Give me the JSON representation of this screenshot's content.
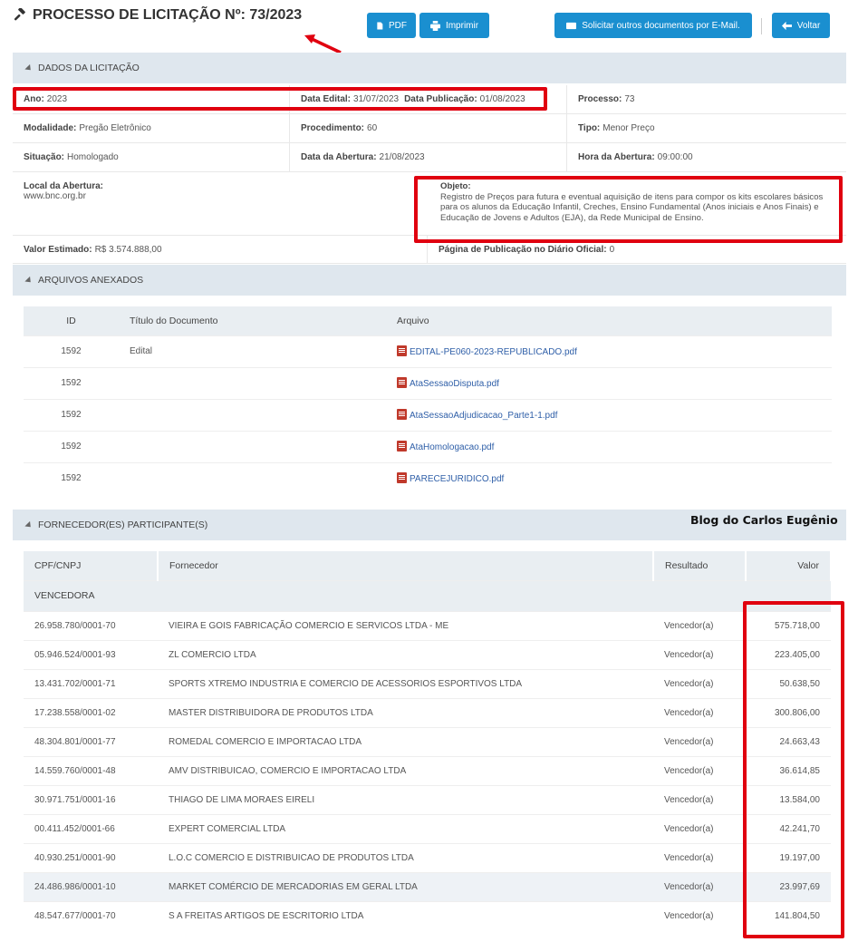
{
  "header": {
    "title": "PROCESSO DE LICITAÇÃO Nº: 73/2023",
    "pdf_label": "PDF",
    "print_label": "Imprimir",
    "email_label": "Solicitar outros documentos por E-Mail.",
    "back_label": "Voltar"
  },
  "dados": {
    "section_title": "DADOS DA LICITAÇÃO",
    "ano_label": "Ano:",
    "ano": "2023",
    "data_edital_label": "Data Edital:",
    "data_edital": "31/07/2023",
    "data_publicacao_label": "Data Publicação:",
    "data_publicacao": "01/08/2023",
    "processo_label": "Processo:",
    "processo": "73",
    "modalidade_label": "Modalidade:",
    "modalidade": "Pregão Eletrônico",
    "procedimento_label": "Procedimento:",
    "procedimento": "60",
    "tipo_label": "Tipo:",
    "tipo": "Menor Preço",
    "situacao_label": "Situação:",
    "situacao": "Homologado",
    "data_abertura_label": "Data da Abertura:",
    "data_abertura": "21/08/2023",
    "hora_abertura_label": "Hora da Abertura:",
    "hora_abertura": "09:00:00",
    "local_label": "Local da Abertura:",
    "local": "www.bnc.org.br",
    "objeto_label": "Objeto:",
    "objeto": "Registro de Preços para futura e eventual aquisição de itens para compor os kits escolares básicos para os alunos da Educação Infantil, Creches, Ensino Fundamental (Anos iniciais e Anos Finais) e Educação de Jovens e Adultos (EJA), da Rede Municipal de Ensino.",
    "valor_label": "Valor Estimado:",
    "valor": "R$ 3.574.888,00",
    "pagina_label": "Página de Publicação no Diário Oficial:",
    "pagina": "0"
  },
  "arquivos": {
    "section_title": "ARQUIVOS ANEXADOS",
    "columns": [
      "ID",
      "Título do Documento",
      "Arquivo"
    ],
    "rows": [
      {
        "id": "1592",
        "titulo": "Edital",
        "arquivo": "EDITAL-PE060-2023-REPUBLICADO.pdf"
      },
      {
        "id": "1592",
        "titulo": "",
        "arquivo": "AtaSessaoDisputa.pdf"
      },
      {
        "id": "1592",
        "titulo": "",
        "arquivo": "AtaSessaoAdjudicacao_Parte1-1.pdf"
      },
      {
        "id": "1592",
        "titulo": "",
        "arquivo": "AtaHomologacao.pdf"
      },
      {
        "id": "1592",
        "titulo": "",
        "arquivo": "PARECEJURIDICO.pdf"
      }
    ]
  },
  "fornecedores": {
    "section_title": "FORNECEDOR(ES) PARTICIPANTE(S)",
    "watermark": "Blog do Carlos Eugênio",
    "columns": [
      "CPF/CNPJ",
      "Fornecedor",
      "Resultado",
      "Valor"
    ],
    "group": "VENCEDORA",
    "rows": [
      {
        "cnpj": "26.958.780/0001-70",
        "nome": "VIEIRA E GOIS FABRICAÇÃO COMERCIO E SERVICOS LTDA - ME",
        "resultado": "Vencedor(a)",
        "valor": "575.718,00"
      },
      {
        "cnpj": "05.946.524/0001-93",
        "nome": "ZL COMERCIO LTDA",
        "resultado": "Vencedor(a)",
        "valor": "223.405,00"
      },
      {
        "cnpj": "13.431.702/0001-71",
        "nome": "SPORTS XTREMO INDUSTRIA E COMERCIO DE ACESSORIOS ESPORTIVOS LTDA",
        "resultado": "Vencedor(a)",
        "valor": "50.638,50"
      },
      {
        "cnpj": "17.238.558/0001-02",
        "nome": "MASTER DISTRIBUIDORA DE PRODUTOS LTDA",
        "resultado": "Vencedor(a)",
        "valor": "300.806,00"
      },
      {
        "cnpj": "48.304.801/0001-77",
        "nome": "ROMEDAL COMERCIO E IMPORTACAO LTDA",
        "resultado": "Vencedor(a)",
        "valor": "24.663,43"
      },
      {
        "cnpj": "14.559.760/0001-48",
        "nome": "AMV DISTRIBUICAO, COMERCIO E IMPORTACAO LTDA",
        "resultado": "Vencedor(a)",
        "valor": "36.614,85"
      },
      {
        "cnpj": "30.971.751/0001-16",
        "nome": "THIAGO DE LIMA MORAES EIRELI",
        "resultado": "Vencedor(a)",
        "valor": "13.584,00"
      },
      {
        "cnpj": "00.411.452/0001-66",
        "nome": "EXPERT COMERCIAL LTDA",
        "resultado": "Vencedor(a)",
        "valor": "42.241,70"
      },
      {
        "cnpj": "40.930.251/0001-90",
        "nome": "L.O.C COMERCIO E DISTRIBUICAO DE PRODUTOS LTDA",
        "resultado": "Vencedor(a)",
        "valor": "19.197,00"
      },
      {
        "cnpj": "24.486.986/0001-10",
        "nome": "MARKET COMÉRCIO DE MERCADORIAS EM GERAL LTDA",
        "resultado": "Vencedor(a)",
        "valor": "23.997,69"
      },
      {
        "cnpj": "48.547.677/0001-70",
        "nome": "S A FREITAS ARTIGOS DE ESCRITORIO LTDA",
        "resultado": "Vencedor(a)",
        "valor": "141.804,50"
      }
    ]
  },
  "colors": {
    "button": "#1a8fd0",
    "section_bg": "#dfe7ee",
    "highlight": "#e0000f",
    "link": "#2f5fa8"
  }
}
